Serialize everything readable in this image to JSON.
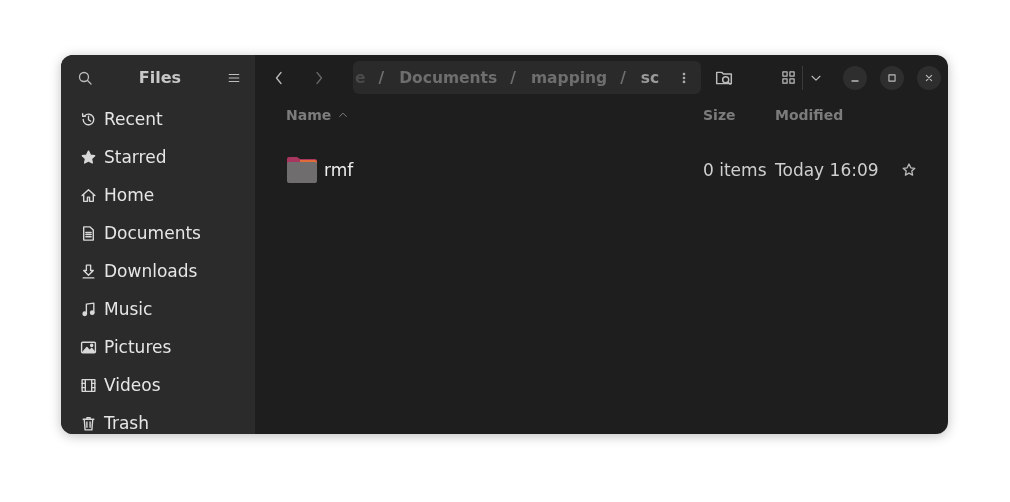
{
  "sidebar": {
    "title": "Files",
    "items": [
      {
        "label": "Recent",
        "kind": "recent"
      },
      {
        "label": "Starred",
        "kind": "starred"
      },
      {
        "label": "Home",
        "kind": "home"
      },
      {
        "label": "Documents",
        "kind": "documents"
      },
      {
        "label": "Downloads",
        "kind": "downloads"
      },
      {
        "label": "Music",
        "kind": "music"
      },
      {
        "label": "Pictures",
        "kind": "pictures"
      },
      {
        "label": "Videos",
        "kind": "videos"
      },
      {
        "label": "Trash",
        "kind": "trash"
      }
    ]
  },
  "path_separator": "/",
  "breadcrumb": [
    {
      "label": "e",
      "selected": false,
      "clipped": true
    },
    {
      "label": "Documents",
      "selected": false,
      "clipped": false
    },
    {
      "label": "mapping",
      "selected": false,
      "clipped": false
    },
    {
      "label": "sc",
      "selected": true,
      "clipped": false
    }
  ],
  "table": {
    "columns": [
      {
        "label": "Name",
        "sorted": true
      },
      {
        "label": "Size",
        "sorted": false
      },
      {
        "label": "Modified",
        "sorted": false
      }
    ],
    "rows": [
      {
        "name": "rmf",
        "kind": "folder",
        "size": "0 items",
        "modified": "Today 16:09",
        "starred": false
      }
    ]
  }
}
